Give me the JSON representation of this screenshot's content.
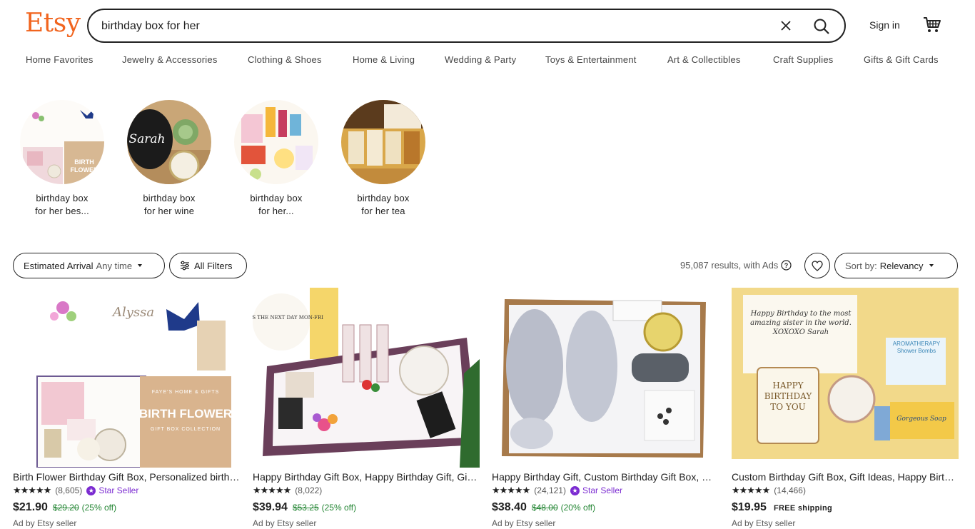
{
  "header": {
    "logo": "Etsy",
    "search_value": "birthday box for her",
    "sign_in": "Sign in",
    "icons": {
      "clear": "close-icon",
      "search": "search-icon",
      "cart": "cart-icon"
    }
  },
  "categories": [
    "Home Favorites",
    "Jewelry & Accessories",
    "Clothing & Shoes",
    "Home & Living",
    "Wedding & Party",
    "Toys & Entertainment",
    "Art & Collectibles",
    "Craft Supplies",
    "Gifts & Gift Cards"
  ],
  "related": [
    {
      "line1": "birthday box",
      "line2": "for her bes..."
    },
    {
      "line1": "birthday box",
      "line2": "for her wine"
    },
    {
      "line1": "birthday box",
      "line2": "for her..."
    },
    {
      "line1": "birthday box",
      "line2": "for her tea"
    }
  ],
  "filters": {
    "arrival_label": "Estimated Arrival",
    "arrival_value": "Any time",
    "all_filters": "All Filters",
    "results": "95,087 results, with Ads",
    "sort_label": "Sort by:",
    "sort_value": "Relevancy"
  },
  "products": [
    {
      "title": "Birth Flower Birthday Gift Box, Personalized birthday gift",
      "stars": "★★★★★",
      "count": "(8,605)",
      "star_seller": "Star Seller",
      "price": "$21.90",
      "orig": "$29.20",
      "pct": "(25% off)",
      "free": "",
      "ad": "Ad by Etsy seller"
    },
    {
      "title": "Happy Birthday Gift Box, Happy Birthday Gift, Gift for her",
      "stars": "★★★★★",
      "count": "(8,022)",
      "star_seller": "",
      "price": "$39.94",
      "orig": "$53.25",
      "pct": "(25% off)",
      "free": "",
      "ad": "Ad by Etsy seller"
    },
    {
      "title": "Happy Birthday Gift, Custom Birthday Gift Box, Gift for her",
      "stars": "★★★★★",
      "count": "(24,121)",
      "star_seller": "Star Seller",
      "price": "$38.40",
      "orig": "$48.00",
      "pct": "(20% off)",
      "free": "",
      "ad": "Ad by Etsy seller"
    },
    {
      "title": "Custom Birthday Gift Box, Gift Ideas, Happy Birthday Sister",
      "stars": "★★★★★",
      "count": "(14,466)",
      "star_seller": "",
      "price": "$19.95",
      "orig": "",
      "pct": "",
      "free": "FREE shipping",
      "ad": "Ad by Etsy seller"
    }
  ],
  "product_images": {
    "p1": {
      "note_title": "Alyssa",
      "box_text": "BIRTH FLOWER",
      "box_sub": "GIFT BOX COLLECTION",
      "brand": "FAYE'S HOME & GIFTS"
    },
    "p2": {
      "ship_text": "SHIPS THE NEXT DAY MON-FRI"
    },
    "p4": {
      "card": "Happy Birthday to the most amazing sister in the world. XOXOXO Sarah",
      "mug": "HAPPY BIRTHDAY TO YOU",
      "soap": "Gorgeous Soap",
      "bomb": "AROMATHERAPY Shower Bombs"
    }
  },
  "related_images": {
    "r2_name": "Sarah"
  },
  "colors": {
    "brand": "#f1641e",
    "star_seller": "#7b2bd1",
    "discount": "#258635"
  }
}
